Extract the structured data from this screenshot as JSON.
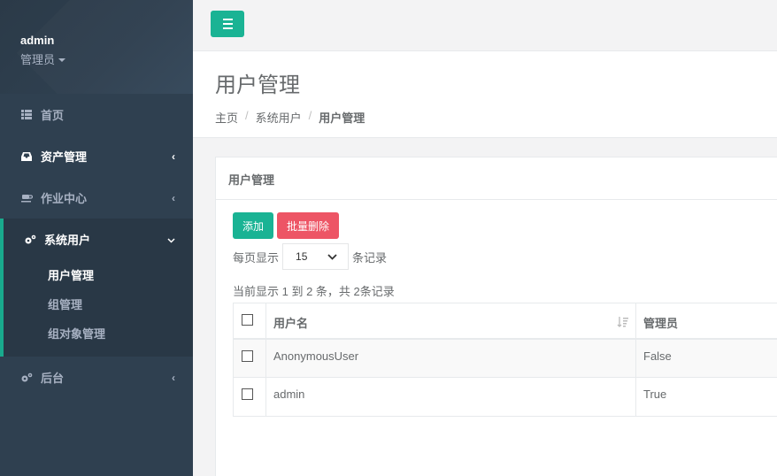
{
  "sidebar": {
    "profile": {
      "name": "admin",
      "role": "管理员"
    },
    "items": [
      {
        "label": "首页",
        "icon": "table-icon"
      },
      {
        "label": "资产管理",
        "icon": "inbox-icon"
      },
      {
        "label": "作业中心",
        "icon": "coffee-icon"
      },
      {
        "label": "系统用户",
        "icon": "gears-icon"
      },
      {
        "label": "后台",
        "icon": "gears-icon"
      }
    ],
    "subitems": [
      {
        "label": "用户管理"
      },
      {
        "label": "组管理"
      },
      {
        "label": "组对象管理"
      }
    ]
  },
  "topbar": {
    "menu_icon": "bars-icon"
  },
  "heading": {
    "title": "用户管理",
    "breadcrumb": [
      "主页",
      "系统用户",
      "用户管理"
    ]
  },
  "panel": {
    "title": "用户管理",
    "add_label": "添加",
    "bulk_delete_label": "批量删除",
    "per_page_prefix": "每页显示",
    "per_page_value": "15",
    "per_page_suffix": "条记录",
    "info": "当前显示 1 到 2 条，共 2条记录"
  },
  "table": {
    "columns": [
      "用户名",
      "管理员"
    ],
    "rows": [
      {
        "username": "AnonymousUser",
        "is_admin": "False"
      },
      {
        "username": "admin",
        "is_admin": "True"
      }
    ]
  },
  "colors": {
    "sidebar_bg": "#2f4050",
    "accent": "#1ab394",
    "danger": "#ed5565"
  }
}
